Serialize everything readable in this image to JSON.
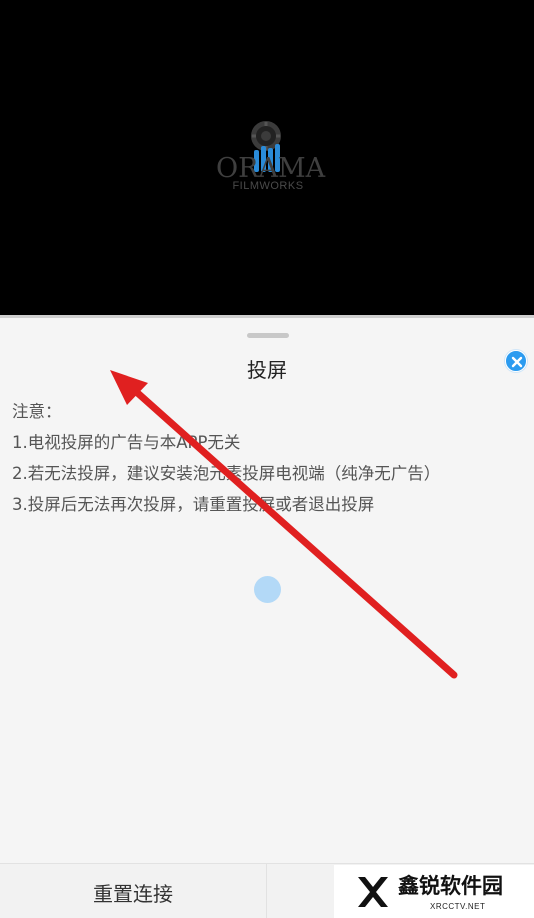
{
  "video": {
    "logo": {
      "brand_text": "ORAMA",
      "sub_text": "FILMWORKS"
    }
  },
  "sheet": {
    "title": "投屏",
    "notes": [
      "注意：",
      "1.电视投屏的广告与本APP无关",
      "2.若无法投屏，建议安装泡元素投屏电视端（纯净无广告）",
      "3.投屏后无法再次投屏，请重置投屏或者退出投屏"
    ]
  },
  "bottom_bar": {
    "reset_label": "重置连接"
  },
  "watermark": {
    "title": "鑫锐软件园",
    "sub": "XRCCTV.NET"
  },
  "colors": {
    "accent": "#2b9bf0",
    "spinner": "#b3d9f7",
    "annotation_arrow": "#e02020"
  },
  "icons": {
    "close": "close-icon",
    "loading": "loading-spinner-icon",
    "annotation": "red-arrow-annotation"
  }
}
